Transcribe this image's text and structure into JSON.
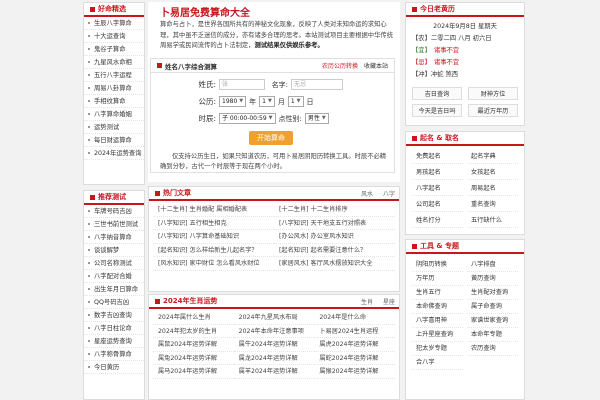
{
  "left": {
    "section1_title": "好命精选",
    "section1_items": [
      "生辰八字算命",
      "十大运查询",
      "鬼谷子算命",
      "九星风水命相",
      "五行八字运程",
      "周易八卦算命",
      "手相纹算命",
      "八字算命婚姻",
      "运势测试",
      "每日财运算命",
      "2024年运势查询"
    ],
    "section2_title": "推荐测试",
    "section2_items": [
      "车牌号码吉凶",
      "三世书前世测试",
      "八字纳音算命",
      "谈谈解梦",
      "公司名称测试",
      "八字配对合婚",
      "出生年月日算命",
      "QQ号码吉凶",
      "数字吉凶查询",
      "八字日柱论命",
      "星座运势查询",
      "八字称骨算命",
      "今日黄历"
    ]
  },
  "main": {
    "title": "卜易居免费算命大全",
    "intro_pre": "算命与占卜，是世界各国所共有的神秘文化现象，反映了人类对未知命运的求知心理，其中虽不乏迷信的成分，亦有诸多合理的思考。本站测试项目主要根据中华传统周易学或民间流传的占卜法制定，",
    "intro_bold": "测试结果仅供娱乐参考。",
    "form_title": "姓名八字综合测算",
    "form_link1": "农历公历转换",
    "form_link2": "收藏本站",
    "surname_label": "姓氏:",
    "surname_placeholder": "张",
    "name_label": "名字:",
    "name_placeholder": "无忌",
    "date_label": "公历:",
    "year": "1980",
    "year_unit": "年",
    "month": "1",
    "month_unit": "月",
    "day": "1",
    "day_unit": "日",
    "time_label": "时辰:",
    "hour": "子 00:00-00:59",
    "gender_label": "点性别:",
    "gender": "男性",
    "submit": "开始算命",
    "note": "仅支持公历生日，如果只知道农历，可用卜易居阴阳历转换工具。时辰不必精确到分秒，古代一个时辰等于现在两个小时。",
    "hot_title": "热门文章",
    "hot_tab1": "风水",
    "hot_tab2": "八字",
    "hot_items": [
      "[十二生肖] 生肖婚配 属相婚配表",
      "[十二生肖] 十二生肖排序",
      "[八字知识] 五行相生相克",
      "[八字知识] 天干地支五行对照表",
      "[八字知识] 八字算命基础知识",
      "[办公风水] 办公室风水知识",
      "[起名知识] 怎么样给新生儿起名字？",
      "[起名知识] 起名需要注意什么？",
      "[风水知识] 家中财位 怎么看风水财位",
      "[家居风水] 客厅风水摆放知识大全"
    ],
    "fortune_title": "2024年生肖运势",
    "fortune_tab1": "生肖",
    "fortune_tab2": "星座",
    "fortune_items": [
      "2024年属什么生肖",
      "2024年九星风水布局",
      "2024年是什么命",
      "2024年犯太岁的生肖",
      "2024年本命年注意事项",
      "卜易居2024生肖运程",
      "属鼠2024年运势详解",
      "属牛2024年运势详解",
      "属虎2024年运势详解",
      "属兔2024年运势详解",
      "属龙2024年运势详解",
      "属蛇2024年运势详解",
      "属马2024年运势详解",
      "属羊2024年运势详解",
      "属猴2024年运势详解"
    ]
  },
  "right": {
    "cal_title": "今日老黄历",
    "date_line": "2024年9月8日 星期天",
    "lunar_line": "二零二四 八月 初六日",
    "lunar_tag": "【农】",
    "yi_tag": "【宜】",
    "yi_text": "诸事不宜",
    "ji_tag": "【忌】",
    "ji_text": "诸事不宜",
    "chong_tag": "【冲】",
    "chong_text": "冲蛇 煞西",
    "cal_btns": [
      "吉日查询",
      "财神方位",
      "今天是吉日吗",
      "最近万年历"
    ],
    "name_title": "起名 & 取名",
    "name_items": [
      "免费起名",
      "起名字典",
      "男孩起名",
      "女孩起名",
      "八字起名",
      "周易起名",
      "公司起名",
      "重名查询",
      "姓名打分",
      "五行缺什么"
    ],
    "tools_title": "工具 & 专题",
    "tool_items": [
      "阴阳历转换",
      "八字排盘",
      "万年历",
      "黄历查询",
      "生肖五行",
      "生肖配对查询",
      "本命佛查询",
      "属子命查询",
      "八字喜用神",
      "家谱世家查询",
      "上升星座查询",
      "本命年专题",
      "犯太岁专题",
      "农历查询",
      "合八字"
    ],
    "colors": {
      "accent": "#c8161d",
      "button": "#f0a030"
    }
  }
}
